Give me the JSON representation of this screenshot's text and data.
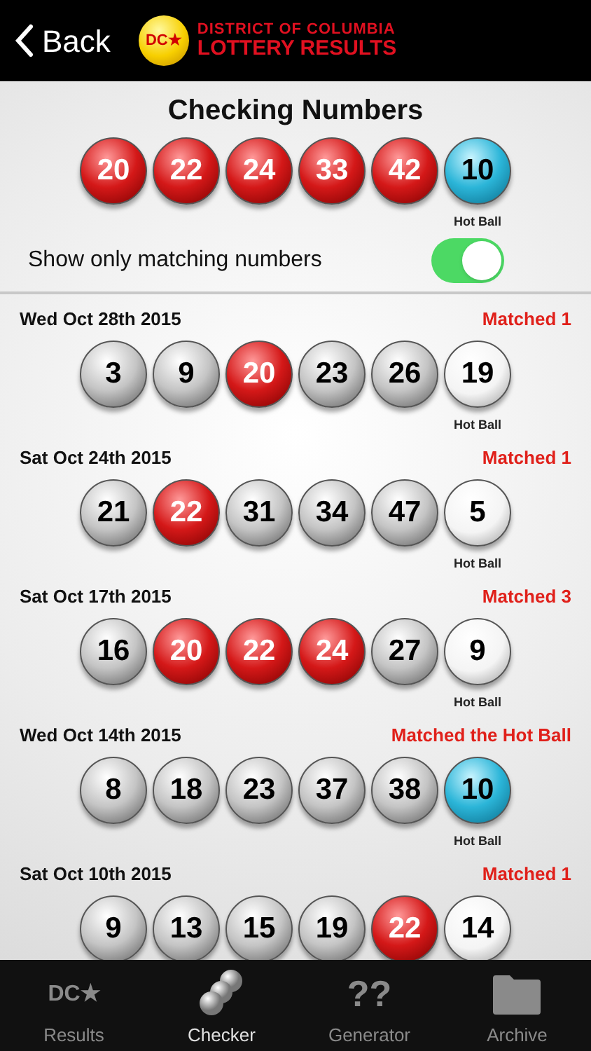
{
  "header": {
    "back": "Back",
    "logo_badge": "DC★",
    "logo_line_1": "DISTRICT OF COLUMBIA",
    "logo_line_2": "LOTTERY RESULTS"
  },
  "checking": {
    "title": "Checking Numbers",
    "balls": [
      {
        "number": "20",
        "kind": "main",
        "matched": true
      },
      {
        "number": "22",
        "kind": "main",
        "matched": true
      },
      {
        "number": "24",
        "kind": "main",
        "matched": true
      },
      {
        "number": "33",
        "kind": "main",
        "matched": true
      },
      {
        "number": "42",
        "kind": "main",
        "matched": true
      },
      {
        "number": "10",
        "kind": "hot",
        "matched": true
      }
    ],
    "hot_label": "Hot Ball"
  },
  "filter": {
    "label": "Show only matching numbers",
    "on": true
  },
  "draws": [
    {
      "date": "Wed Oct 28th 2015",
      "result": "Matched 1",
      "hot_label": "Hot Ball",
      "balls": [
        {
          "number": "3",
          "kind": "main",
          "matched": false
        },
        {
          "number": "9",
          "kind": "main",
          "matched": false
        },
        {
          "number": "20",
          "kind": "main",
          "matched": true
        },
        {
          "number": "23",
          "kind": "main",
          "matched": false
        },
        {
          "number": "26",
          "kind": "main",
          "matched": false
        },
        {
          "number": "19",
          "kind": "hot",
          "matched": false
        }
      ]
    },
    {
      "date": "Sat Oct 24th 2015",
      "result": "Matched 1",
      "hot_label": "Hot Ball",
      "balls": [
        {
          "number": "21",
          "kind": "main",
          "matched": false
        },
        {
          "number": "22",
          "kind": "main",
          "matched": true
        },
        {
          "number": "31",
          "kind": "main",
          "matched": false
        },
        {
          "number": "34",
          "kind": "main",
          "matched": false
        },
        {
          "number": "47",
          "kind": "main",
          "matched": false
        },
        {
          "number": "5",
          "kind": "hot",
          "matched": false
        }
      ]
    },
    {
      "date": "Sat Oct 17th 2015",
      "result": "Matched 3",
      "hot_label": "Hot Ball",
      "balls": [
        {
          "number": "16",
          "kind": "main",
          "matched": false
        },
        {
          "number": "20",
          "kind": "main",
          "matched": true
        },
        {
          "number": "22",
          "kind": "main",
          "matched": true
        },
        {
          "number": "24",
          "kind": "main",
          "matched": true
        },
        {
          "number": "27",
          "kind": "main",
          "matched": false
        },
        {
          "number": "9",
          "kind": "hot",
          "matched": false
        }
      ]
    },
    {
      "date": "Wed Oct 14th 2015",
      "result": "Matched the Hot Ball",
      "hot_label": "Hot Ball",
      "balls": [
        {
          "number": "8",
          "kind": "main",
          "matched": false
        },
        {
          "number": "18",
          "kind": "main",
          "matched": false
        },
        {
          "number": "23",
          "kind": "main",
          "matched": false
        },
        {
          "number": "37",
          "kind": "main",
          "matched": false
        },
        {
          "number": "38",
          "kind": "main",
          "matched": false
        },
        {
          "number": "10",
          "kind": "hot",
          "matched": true
        }
      ]
    },
    {
      "date": "Sat Oct 10th 2015",
      "result": "Matched 1",
      "balls": [
        {
          "number": "9",
          "kind": "main",
          "matched": false
        },
        {
          "number": "13",
          "kind": "main",
          "matched": false
        },
        {
          "number": "15",
          "kind": "main",
          "matched": false
        },
        {
          "number": "19",
          "kind": "main",
          "matched": false
        },
        {
          "number": "22",
          "kind": "main",
          "matched": true
        },
        {
          "number": "14",
          "kind": "hot",
          "matched": false
        }
      ]
    }
  ],
  "tabs": [
    {
      "label": "Results",
      "kind": "logo",
      "glyph": "DC★",
      "selected": false
    },
    {
      "label": "Checker",
      "kind": "balls",
      "selected": true
    },
    {
      "label": "Generator",
      "kind": "glyph",
      "glyph": "??",
      "selected": false
    },
    {
      "label": "Archive",
      "kind": "folder",
      "selected": false
    }
  ]
}
